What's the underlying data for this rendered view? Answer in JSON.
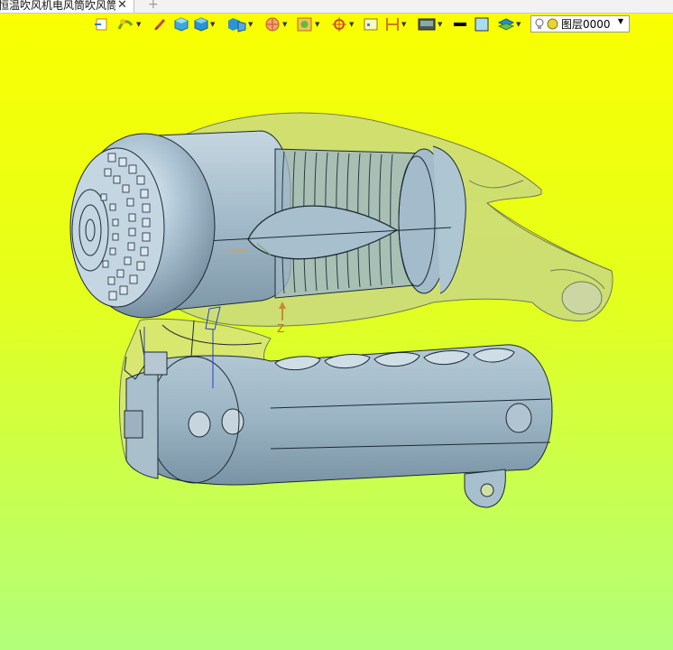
{
  "tab": {
    "title": "恒温吹风机电风筒吹风筒]",
    "close": "✕",
    "new_tab": "+"
  },
  "toolbar": {
    "buttons": [
      {
        "name": "view-fit-icon",
        "caret": false
      },
      {
        "name": "render-mode-icon",
        "caret": true
      },
      {
        "name": "pen-icon",
        "caret": false
      },
      {
        "name": "cube-wire-icon",
        "caret": false
      },
      {
        "name": "cube-solid-icon",
        "caret": true
      },
      {
        "name": "cube-shade-icon",
        "caret": true
      },
      {
        "name": "section-icon",
        "caret": true
      },
      {
        "name": "material-icon",
        "caret": true
      },
      {
        "name": "target-icon",
        "caret": true
      },
      {
        "name": "sheet-icon",
        "caret": false
      },
      {
        "name": "dimension-icon",
        "caret": true
      },
      {
        "name": "display-icon",
        "caret": true
      },
      {
        "name": "line-color-icon",
        "caret": false
      },
      {
        "name": "face-color-icon",
        "caret": false
      },
      {
        "name": "layers-icon",
        "caret": true
      }
    ],
    "layer": {
      "label": "图层0000",
      "dropdown": "▼"
    }
  },
  "viewport": {
    "axis_label": "Z"
  },
  "colors": {
    "bg_top": "#fbff00",
    "bg_bottom": "#b2ff7b",
    "body_fill": "#9fb7c6",
    "shell_fill": "#c9d69a",
    "outline": "#1c2a33"
  }
}
